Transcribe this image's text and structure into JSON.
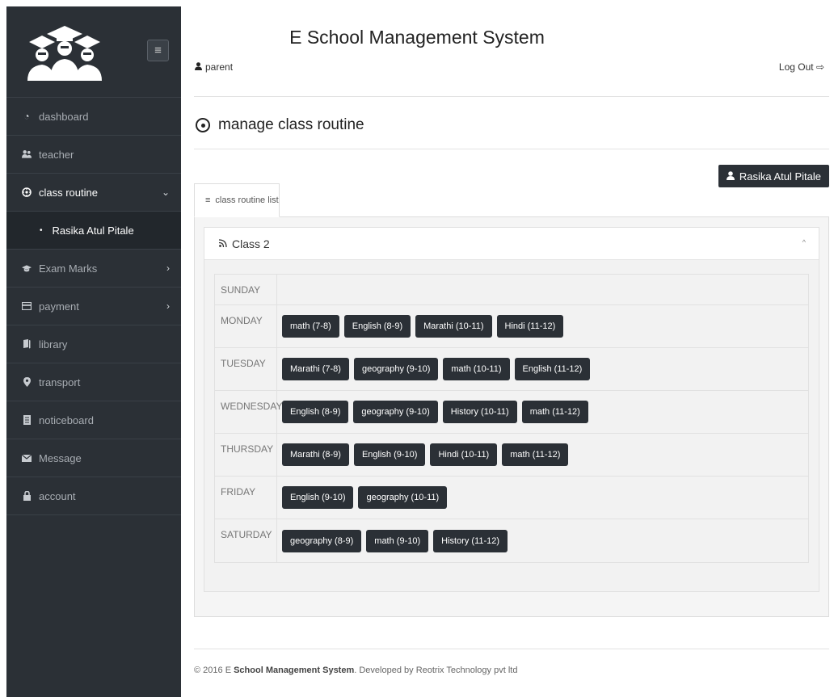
{
  "app_title": "E School Management System",
  "user_role": "parent",
  "logout_label": "Log Out",
  "page_heading": "manage class routine",
  "student_button": "Rasika Atul Pitale",
  "tab_label": "class routine list",
  "panel_title": "Class 2",
  "sidebar": {
    "items": [
      {
        "label": "dashboard",
        "icon": "gauge-icon"
      },
      {
        "label": "teacher",
        "icon": "users-icon"
      },
      {
        "label": "class routine",
        "icon": "target-icon"
      },
      {
        "label": "Exam Marks",
        "icon": "graduation-cap-icon"
      },
      {
        "label": "payment",
        "icon": "credit-card-icon"
      },
      {
        "label": "library",
        "icon": "book-icon"
      },
      {
        "label": "transport",
        "icon": "map-marker-icon"
      },
      {
        "label": "noticeboard",
        "icon": "notice-icon"
      },
      {
        "label": "Message",
        "icon": "envelope-icon"
      },
      {
        "label": "account",
        "icon": "lock-icon"
      }
    ],
    "sub_item": "Rasika Atul Pitale"
  },
  "routine": [
    {
      "day": "SUNDAY",
      "periods": []
    },
    {
      "day": "MONDAY",
      "periods": [
        "math (7-8)",
        "English (8-9)",
        "Marathi (10-11)",
        "Hindi (11-12)"
      ]
    },
    {
      "day": "TUESDAY",
      "periods": [
        "Marathi (7-8)",
        "geography (9-10)",
        "math (10-11)",
        "English (11-12)"
      ]
    },
    {
      "day": "WEDNESDAY",
      "periods": [
        "English (8-9)",
        "geography (9-10)",
        "History (10-11)",
        "math (11-12)"
      ]
    },
    {
      "day": "THURSDAY",
      "periods": [
        "Marathi (8-9)",
        "English (9-10)",
        "Hindi (10-11)",
        "math (11-12)"
      ]
    },
    {
      "day": "FRIDAY",
      "periods": [
        "English (9-10)",
        "geography (10-11)"
      ]
    },
    {
      "day": "SATURDAY",
      "periods": [
        "geography (8-9)",
        "math (9-10)",
        "History (11-12)"
      ]
    }
  ],
  "footer": {
    "prefix": "© 2016 E ",
    "brand": "School Management System",
    "middle": ". Developed by ",
    "company": "Reotrix Technology pvt ltd"
  }
}
